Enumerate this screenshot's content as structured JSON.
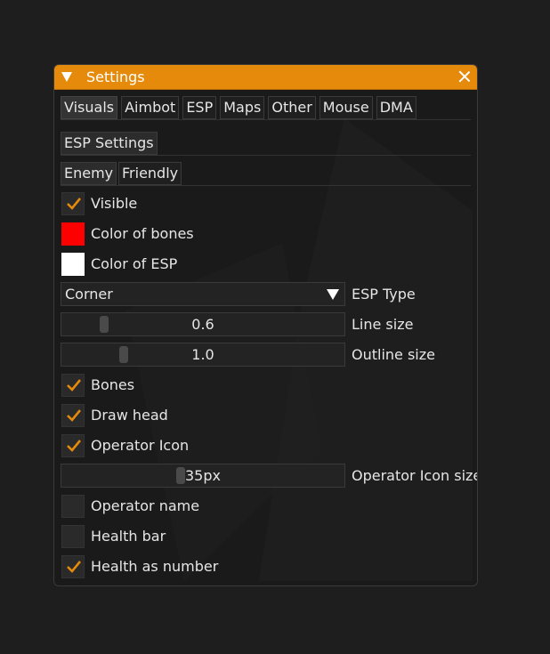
{
  "window": {
    "title": "Settings",
    "accent": "#e58a0b"
  },
  "tabs": [
    {
      "label": "Visuals",
      "active": true
    },
    {
      "label": "Aimbot",
      "active": false
    },
    {
      "label": "ESP",
      "active": false
    },
    {
      "label": "Maps",
      "active": false
    },
    {
      "label": "Other",
      "active": false
    },
    {
      "label": "Mouse",
      "active": false
    },
    {
      "label": "DMA",
      "active": false
    }
  ],
  "section": {
    "header": "ESP Settings",
    "subtabs": [
      "Enemy",
      "Friendly"
    ]
  },
  "settings": {
    "visible": {
      "label": "Visible",
      "checked": true
    },
    "color_bones": {
      "label": "Color of bones",
      "color": "#ff0000"
    },
    "color_esp": {
      "label": "Color of ESP",
      "color": "#ffffff"
    },
    "esp_type": {
      "label": "ESP Type",
      "value": "Corner"
    },
    "line_size": {
      "label": "Line size",
      "value": "0.6",
      "fraction": 0.14
    },
    "outline_size": {
      "label": "Outline size",
      "value": "1.0",
      "fraction": 0.21
    },
    "bones": {
      "label": "Bones",
      "checked": true
    },
    "draw_head": {
      "label": "Draw head",
      "checked": true
    },
    "operator_icon": {
      "label": "Operator Icon",
      "checked": true
    },
    "operator_icon_size": {
      "label": "Operator Icon size",
      "value": "35px",
      "fraction": 0.42
    },
    "operator_name": {
      "label": "Operator name",
      "checked": false
    },
    "health_bar": {
      "label": "Health bar",
      "checked": false
    },
    "health_number": {
      "label": "Health as number",
      "checked": true
    }
  }
}
